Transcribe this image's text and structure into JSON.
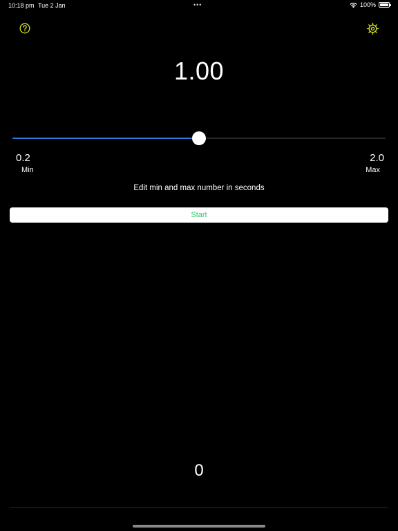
{
  "status_bar": {
    "time": "10:18 pm",
    "date": "Tue 2 Jan",
    "dots": "•••",
    "battery": "100%",
    "battery_level": 1.0
  },
  "header": {
    "help_icon": "question-circle-icon",
    "settings_icon": "gear-icon",
    "icon_color": "#d9e021"
  },
  "main": {
    "current_value": "1.00",
    "slider": {
      "min": 0.2,
      "max": 2.0,
      "value": 1.1,
      "fill_color": "#2f7de1"
    },
    "min_value": "0.2",
    "min_label": "Min",
    "max_value": "2.0",
    "max_label": "Max",
    "hint": "Edit min and max number in seconds",
    "start_label": "Start",
    "start_color": "#3ac26b",
    "counter": "0"
  }
}
